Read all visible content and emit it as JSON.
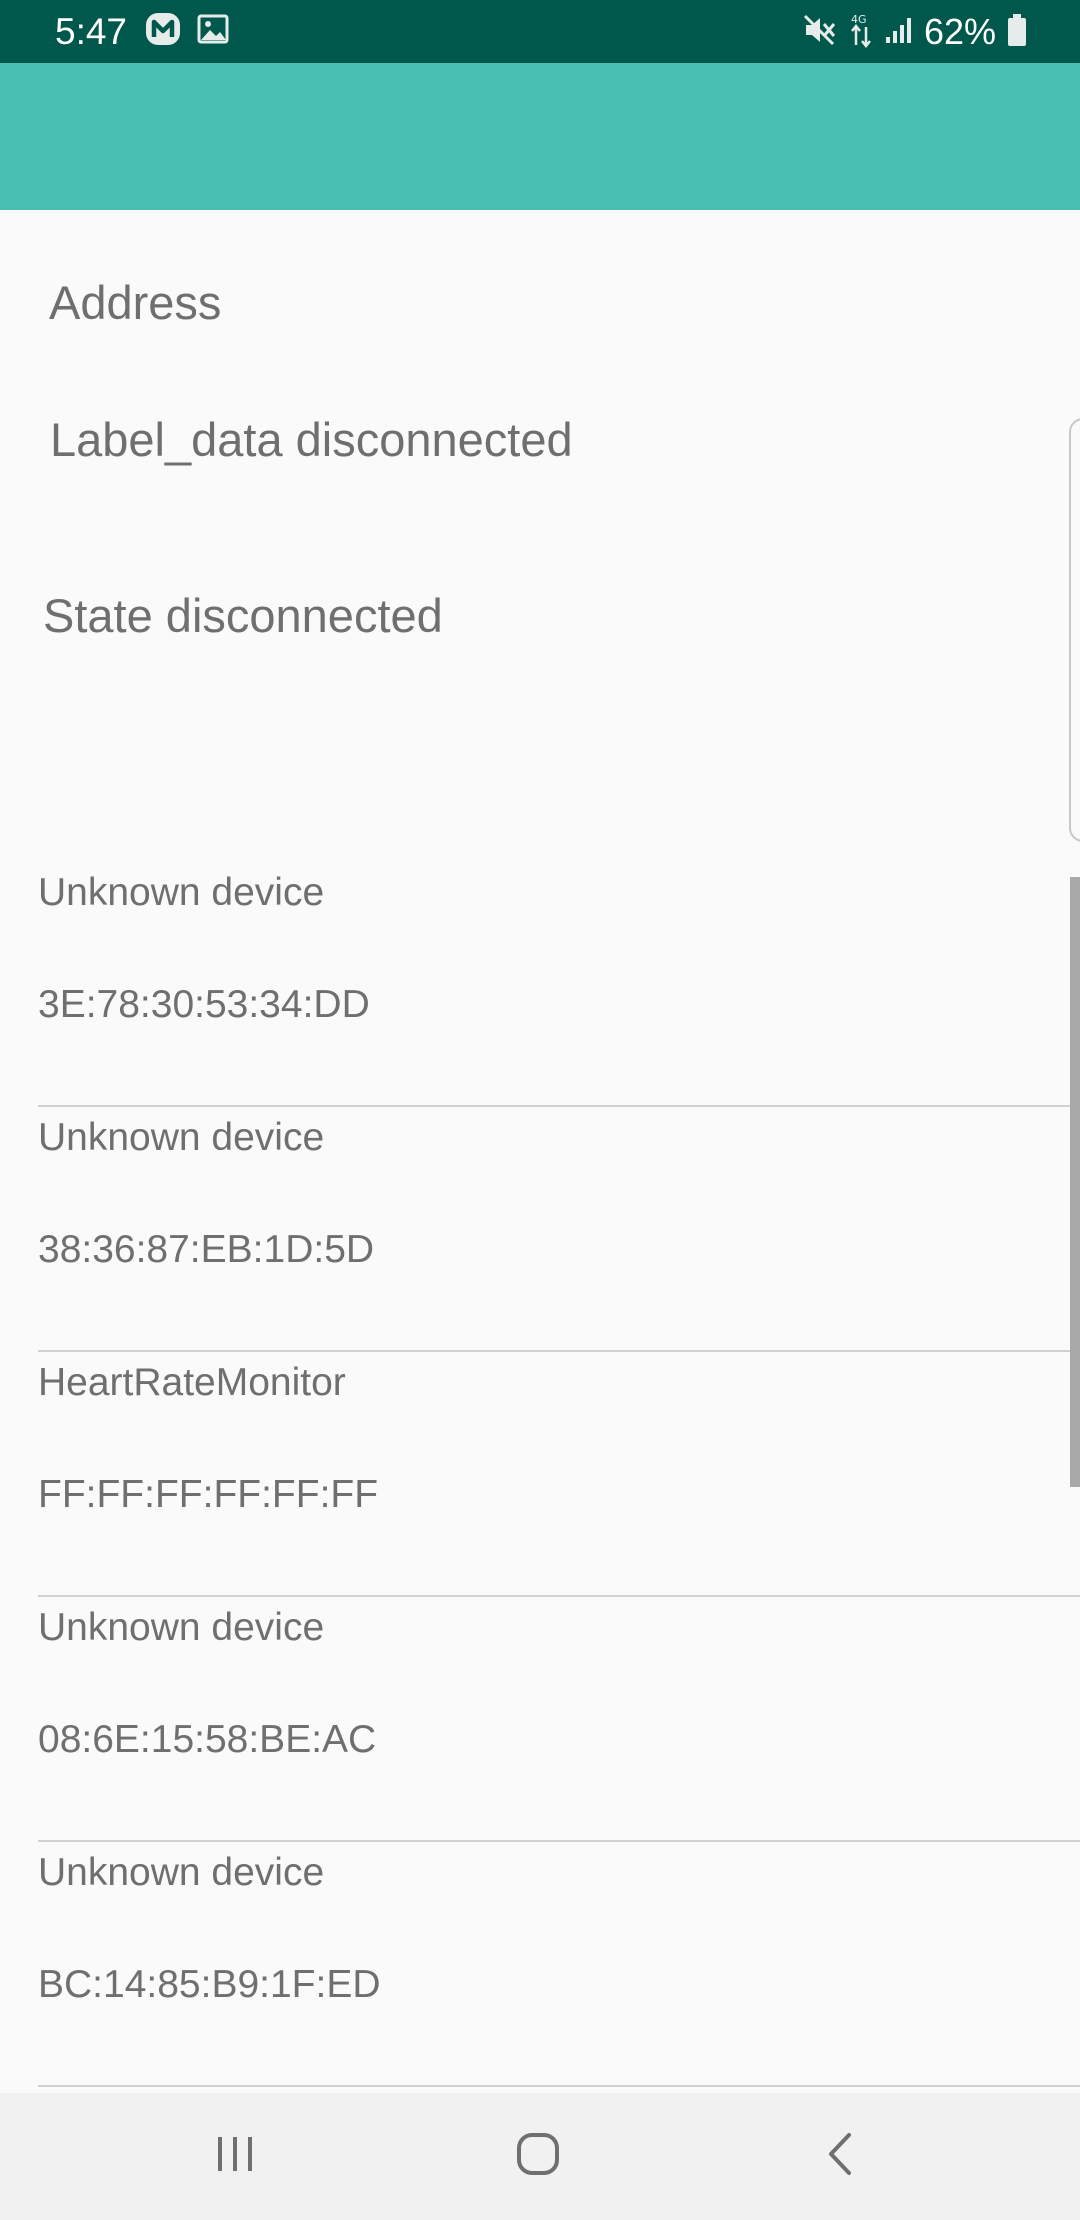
{
  "status_bar": {
    "time": "5:47",
    "left_icons": [
      "m-badge-icon",
      "gallery-icon"
    ],
    "right_icons": [
      "mute-icon",
      "4g-data-icon",
      "signal-icon",
      "battery-icon"
    ],
    "battery": "62%"
  },
  "colors": {
    "status_bar": "#00574b",
    "app_bar": "#48bfb1",
    "background": "#fafafa",
    "text": "#6f6f6f",
    "divider": "#d2d2d2",
    "nav_bar": "#f1f1f1"
  },
  "main": {
    "address_label": "Address",
    "label_data": "Label_data disconnected",
    "state": "State disconnected"
  },
  "devices": [
    {
      "name": "Unknown device",
      "address": "3E:78:30:53:34:DD"
    },
    {
      "name": "Unknown device",
      "address": "38:36:87:EB:1D:5D"
    },
    {
      "name": "HeartRateMonitor",
      "address": "FF:FF:FF:FF:FF:FF"
    },
    {
      "name": "Unknown device",
      "address": "08:6E:15:58:BE:AC"
    },
    {
      "name": "Unknown device",
      "address": "BC:14:85:B9:1F:ED"
    }
  ],
  "nav_bar": {
    "buttons": [
      "recent-apps-icon",
      "home-icon",
      "back-icon"
    ]
  }
}
